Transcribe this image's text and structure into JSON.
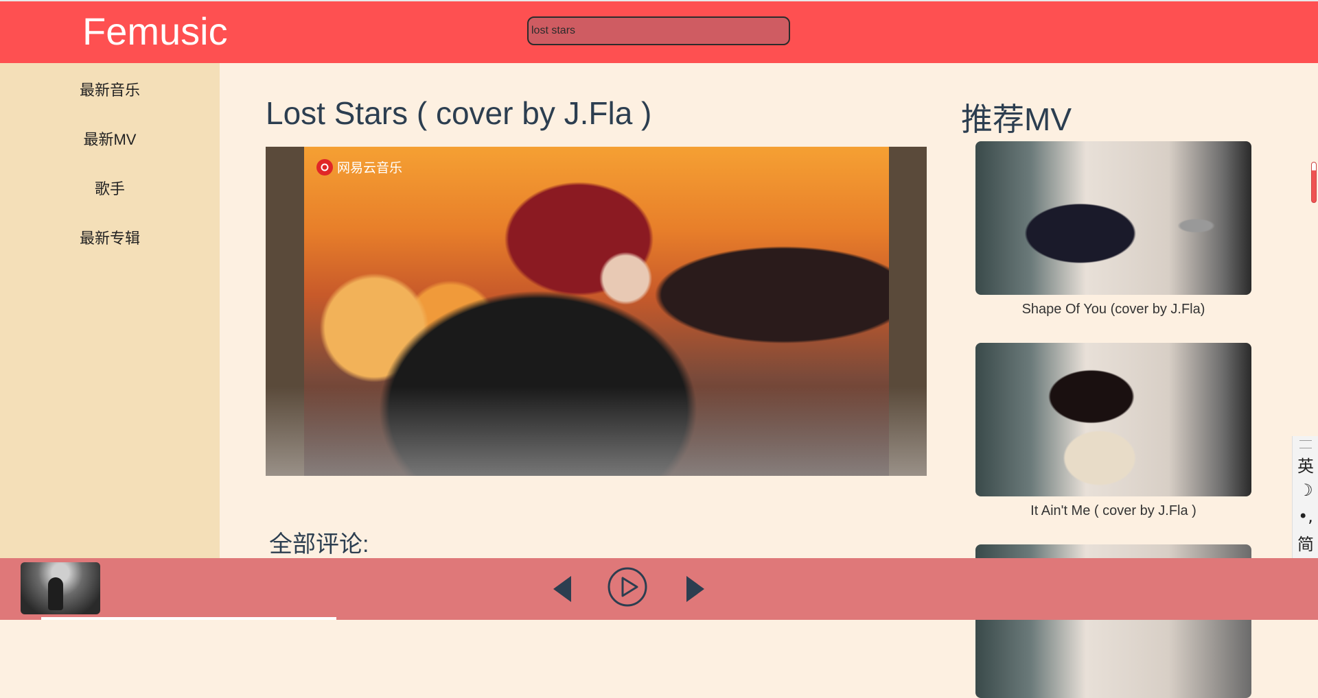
{
  "header": {
    "logo": "Femusic",
    "search": {
      "value": "lost stars",
      "placeholder": ""
    }
  },
  "sidebar": {
    "items": [
      {
        "label": "最新音乐"
      },
      {
        "label": "最新MV"
      },
      {
        "label": "歌手"
      },
      {
        "label": "最新专辑"
      }
    ]
  },
  "main": {
    "title": "Lost Stars ( cover by J.Fla )",
    "video": {
      "watermark": "网易云音乐"
    },
    "comments_title": "全部评论:"
  },
  "recommend": {
    "heading": "推荐MV",
    "items": [
      {
        "caption": "Shape Of You (cover by J.Fla)"
      },
      {
        "caption": "It Ain't Me ( cover by J.Fla )"
      },
      {
        "caption": ""
      }
    ]
  },
  "ime_toolbar": {
    "items": [
      {
        "label": "英",
        "icon": "language-toggle"
      },
      {
        "label": "☽",
        "icon": "moon-icon"
      },
      {
        "label": "•,",
        "icon": "punctuation-icon"
      },
      {
        "label": "简",
        "icon": "simplified-icon"
      },
      {
        "label": "☺",
        "icon": "emoji-icon"
      },
      {
        "label": "⚙",
        "icon": "gear-icon"
      }
    ]
  },
  "player": {
    "controls": [
      "previous-icon",
      "play-icon",
      "next-icon"
    ]
  },
  "colors": {
    "header": "#fe5051",
    "sidebar": "#f4dfb8",
    "background": "#fdf0e1",
    "player": "#df7879",
    "controls": "#2c3e50"
  }
}
